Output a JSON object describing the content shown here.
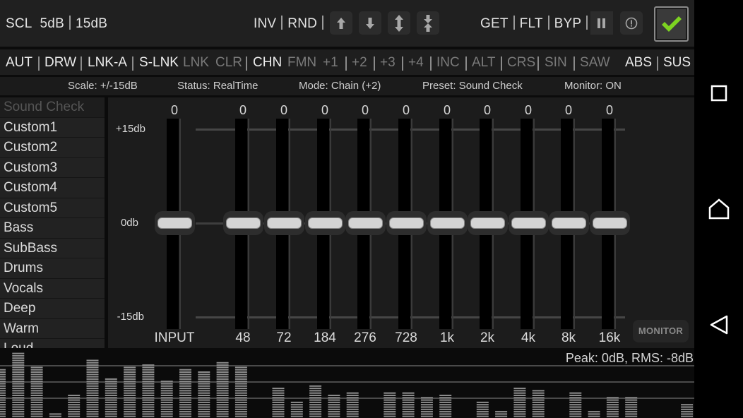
{
  "toolbar1": {
    "scl_label": "SCL",
    "scale_5": "5dB",
    "scale_15": "15dB",
    "inv": "INV",
    "rnd": "RND",
    "icons": [
      "arrow-up-icon",
      "arrow-down-icon",
      "expand-vertical-icon",
      "compress-vertical-icon"
    ],
    "get": "GET",
    "flt": "FLT",
    "byp": "BYP",
    "pause_icon": "pause-icon",
    "info_icon": "info-icon",
    "confirm_icon": "checkmark-icon",
    "confirm_color": "#7dd321"
  },
  "toolbar2": {
    "items": [
      {
        "label": "AUT",
        "active": true
      },
      {
        "label": "DRW",
        "active": true
      },
      {
        "label": "LNK-A",
        "active": true
      },
      {
        "label": "S-LNK",
        "active": true
      },
      {
        "label": "LNK",
        "active": false
      },
      {
        "label": "CLR",
        "active": false
      },
      {
        "label": "CHN",
        "active": true
      },
      {
        "label": "FMN",
        "active": false
      },
      {
        "label": "+1",
        "active": false
      },
      {
        "label": "+2",
        "active": false
      },
      {
        "label": "+3",
        "active": false
      },
      {
        "label": "+4",
        "active": false
      },
      {
        "label": "INC",
        "active": false
      },
      {
        "label": "ALT",
        "active": false
      },
      {
        "label": "CRS",
        "active": false
      },
      {
        "label": "SIN",
        "active": false
      },
      {
        "label": "SAW",
        "active": false
      },
      {
        "label": "ABS",
        "active": true
      },
      {
        "label": "SUS",
        "active": true
      }
    ]
  },
  "status": {
    "scale": "Scale: +/-15dB",
    "status": "Status: RealTime",
    "mode": "Mode: Chain (+2)",
    "preset": "Preset: Sound Check",
    "monitor": "Monitor: ON"
  },
  "presets": {
    "selected": "Sound Check",
    "items": [
      "Sound Check",
      "Custom1",
      "Custom2",
      "Custom3",
      "Custom4",
      "Custom5",
      "Bass",
      "SubBass",
      "Drums",
      "Vocals",
      "Deep",
      "Warm",
      "Loud"
    ]
  },
  "eq": {
    "axis": {
      "top": "+15db",
      "mid": "0db",
      "bottom": "-15db"
    },
    "range_db": [
      -15,
      15
    ],
    "bands": [
      {
        "label": "INPUT",
        "value": 0
      },
      {
        "label": "48",
        "value": 0
      },
      {
        "label": "72",
        "value": 0
      },
      {
        "label": "184",
        "value": 0
      },
      {
        "label": "276",
        "value": 0
      },
      {
        "label": "728",
        "value": 0
      },
      {
        "label": "1k",
        "value": 0
      },
      {
        "label": "2k",
        "value": 0
      },
      {
        "label": "4k",
        "value": 0
      },
      {
        "label": "8k",
        "value": 0
      },
      {
        "label": "16k",
        "value": 0
      }
    ],
    "monitor_button": "MONITOR"
  },
  "spectrum": {
    "readout": "Peak: 0dB, RMS: -8dB",
    "levels": [
      0.75,
      0.98,
      0.78,
      0.1,
      0.36,
      0.88,
      0.62,
      0.78,
      0.82,
      0.59,
      0.75,
      0.72,
      0.86,
      0.78,
      0.0,
      0.46,
      0.25,
      0.52,
      0.36,
      0.4,
      0.0,
      0.4,
      0.4,
      0.34,
      0.38,
      0.0,
      0.26,
      0.12,
      0.46,
      0.42,
      0.0,
      0.4,
      0.12,
      0.34,
      0.34,
      0.0,
      0.0,
      0.24
    ]
  },
  "navbar": {
    "icons": [
      "recent-apps-icon",
      "home-icon",
      "back-icon"
    ]
  }
}
